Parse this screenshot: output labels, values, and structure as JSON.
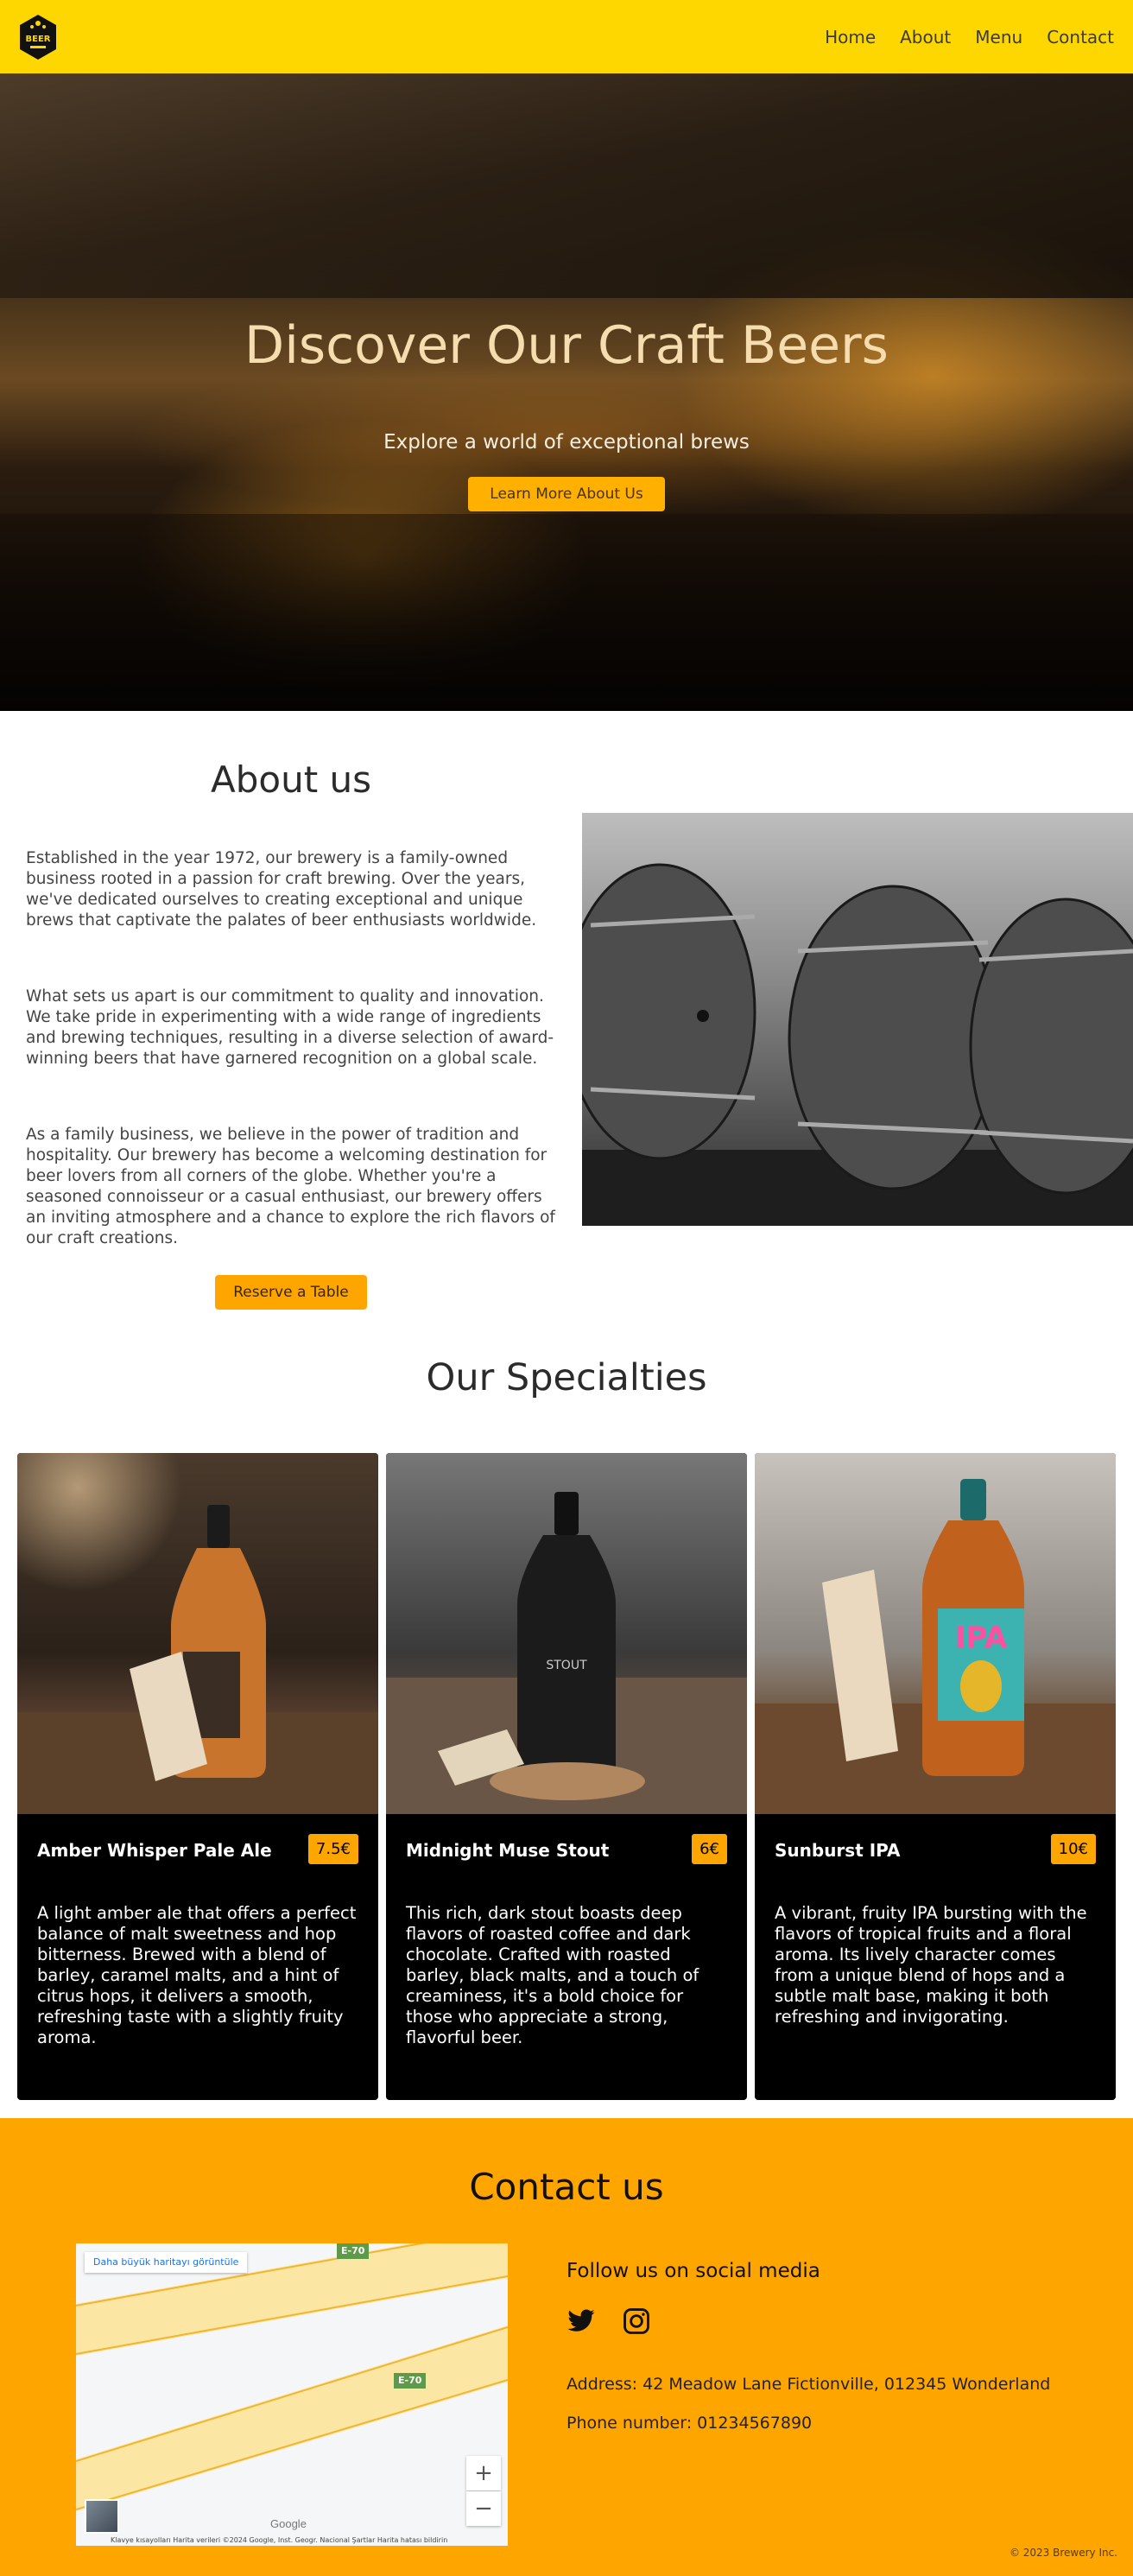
{
  "nav": {
    "logo_text": "BEER",
    "links": [
      "Home",
      "About",
      "Menu",
      "Contact"
    ]
  },
  "hero": {
    "title": "Discover Our Craft Beers",
    "subtitle": "Explore a world of exceptional brews",
    "button": "Learn More About Us"
  },
  "about": {
    "title": "About us",
    "paragraphs": [
      "Established in the year 1972, our brewery is a family-owned business rooted in a passion for craft brewing. Over the years, we've dedicated ourselves to creating exceptional and unique brews that captivate the palates of beer enthusiasts worldwide.",
      "What sets us apart is our commitment to quality and innovation. We take pride in experimenting with a wide range of ingredients and brewing techniques, resulting in a diverse selection of award-winning beers that have garnered recognition on a global scale.",
      "As a family business, we believe in the power of tradition and hospitality. Our brewery has become a welcoming destination for beer lovers from all corners of the globe. Whether you're a seasoned connoisseur or a casual enthusiast, our brewery offers an inviting atmosphere and a chance to explore the rich flavors of our craft creations."
    ],
    "button": "Reserve a Table"
  },
  "specialties": {
    "title": "Our Specialties",
    "items": [
      {
        "name": "Amber Whisper Pale Ale",
        "price": "7.5€",
        "description": "A light amber ale that offers a perfect balance of malt sweetness and hop bitterness. Brewed with a blend of barley, caramel malts, and a hint of citrus hops, it delivers a smooth, refreshing taste with a slightly fruity aroma."
      },
      {
        "name": "Midnight Muse Stout",
        "price": "6€",
        "description": "This rich, dark stout boasts deep flavors of roasted coffee and dark chocolate. Crafted with roasted barley, black malts, and a touch of creaminess, it's a bold choice for those who appreciate a strong, flavorful beer."
      },
      {
        "name": "Sunburst IPA",
        "price": "10€",
        "description": "A vibrant, fruity IPA bursting with the flavors of tropical fruits and a floral aroma. Its lively character comes from a unique blend of hops and a subtle malt base, making it both refreshing and invigorating."
      }
    ]
  },
  "contact": {
    "title": "Contact us",
    "map": {
      "link": "Daha büyük haritayı görüntüle",
      "road_label_1": "E-70",
      "road_label_2": "E-70",
      "zoom_in": "+",
      "zoom_out": "−",
      "google": "Google",
      "attribution": "Klavye kısayolları    Harita verileri ©2024 Google, Inst. Geogr. Nacional    Şartlar    Harita hatası bildirin"
    },
    "follow": "Follow us on social media",
    "social_icons": [
      "twitter-icon",
      "instagram-icon"
    ],
    "address": "Address: 42 Meadow Lane Fictionville, 012345 Wonderland",
    "phone": "Phone number: 01234567890"
  },
  "footer": {
    "copyright": "© 2023 Brewery Inc."
  },
  "colors": {
    "nav_bg": "#ffd700",
    "accent": "#ffa500",
    "card_bg": "#000000"
  }
}
